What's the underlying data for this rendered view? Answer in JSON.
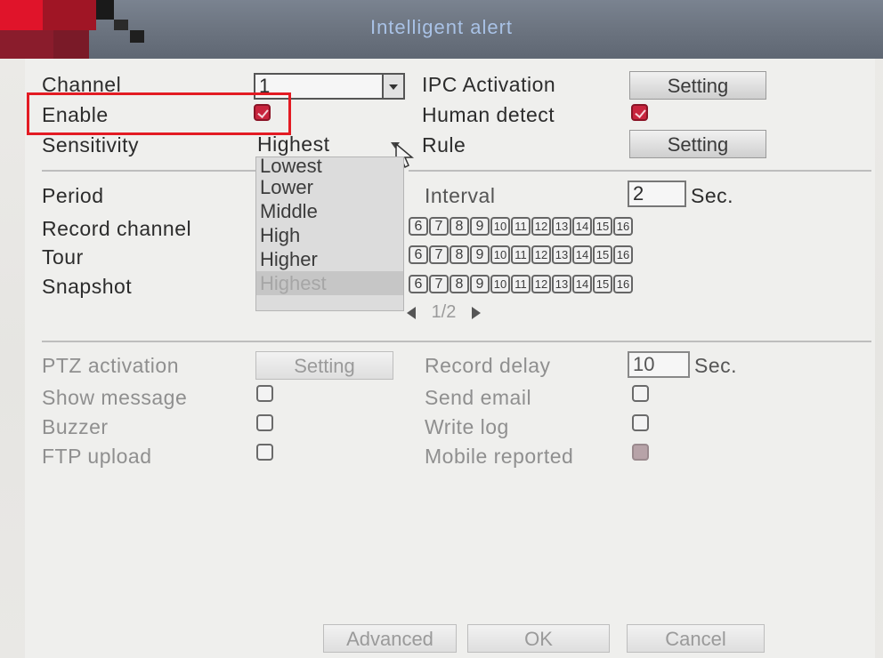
{
  "window": {
    "title": "Intelligent alert"
  },
  "form": {
    "channel_label": "Channel",
    "channel_value": "1",
    "enable_label": "Enable",
    "enable_checked": true,
    "sensitivity_label": "Sensitivity",
    "sensitivity_value": "Highest",
    "ipc_activation_label": "IPC Activation",
    "ipc_activation_button": "Setting",
    "human_detect_label": "Human detect",
    "human_detect_checked": true,
    "rule_label": "Rule",
    "rule_button": "Setting",
    "period_label": "Period",
    "record_channel_label": "Record channel",
    "tour_label": "Tour",
    "snapshot_label": "Snapshot",
    "interval_label": "Interval",
    "interval_value": "2",
    "interval_unit": "Sec.",
    "channel_numbers": [
      "6",
      "7",
      "8",
      "9",
      "10",
      "11",
      "12",
      "13",
      "14",
      "15",
      "16"
    ],
    "pager_prev_icon": "triangle-left-icon",
    "pager_text": "1/2",
    "pager_next_icon": "triangle-right-icon",
    "ptz_activation_label": "PTZ activation",
    "ptz_activation_button": "Setting",
    "record_delay_label": "Record delay",
    "record_delay_value": "10",
    "record_delay_unit": "Sec.",
    "show_message_label": "Show message",
    "send_email_label": "Send email",
    "buzzer_label": "Buzzer",
    "write_log_label": "Write log",
    "ftp_upload_label": "FTP upload",
    "mobile_reported_label": "Mobile reported",
    "mobile_reported_checked": true
  },
  "sensitivity_options": [
    "Lowest",
    "Lower",
    "Middle",
    "High",
    "Higher",
    "Highest"
  ],
  "footer": {
    "advanced": "Advanced",
    "ok": "OK",
    "cancel": "Cancel"
  },
  "colors": {
    "accent": "#c8243d",
    "title_text": "#a9c2e6",
    "highlight_box": "#e31b23"
  }
}
